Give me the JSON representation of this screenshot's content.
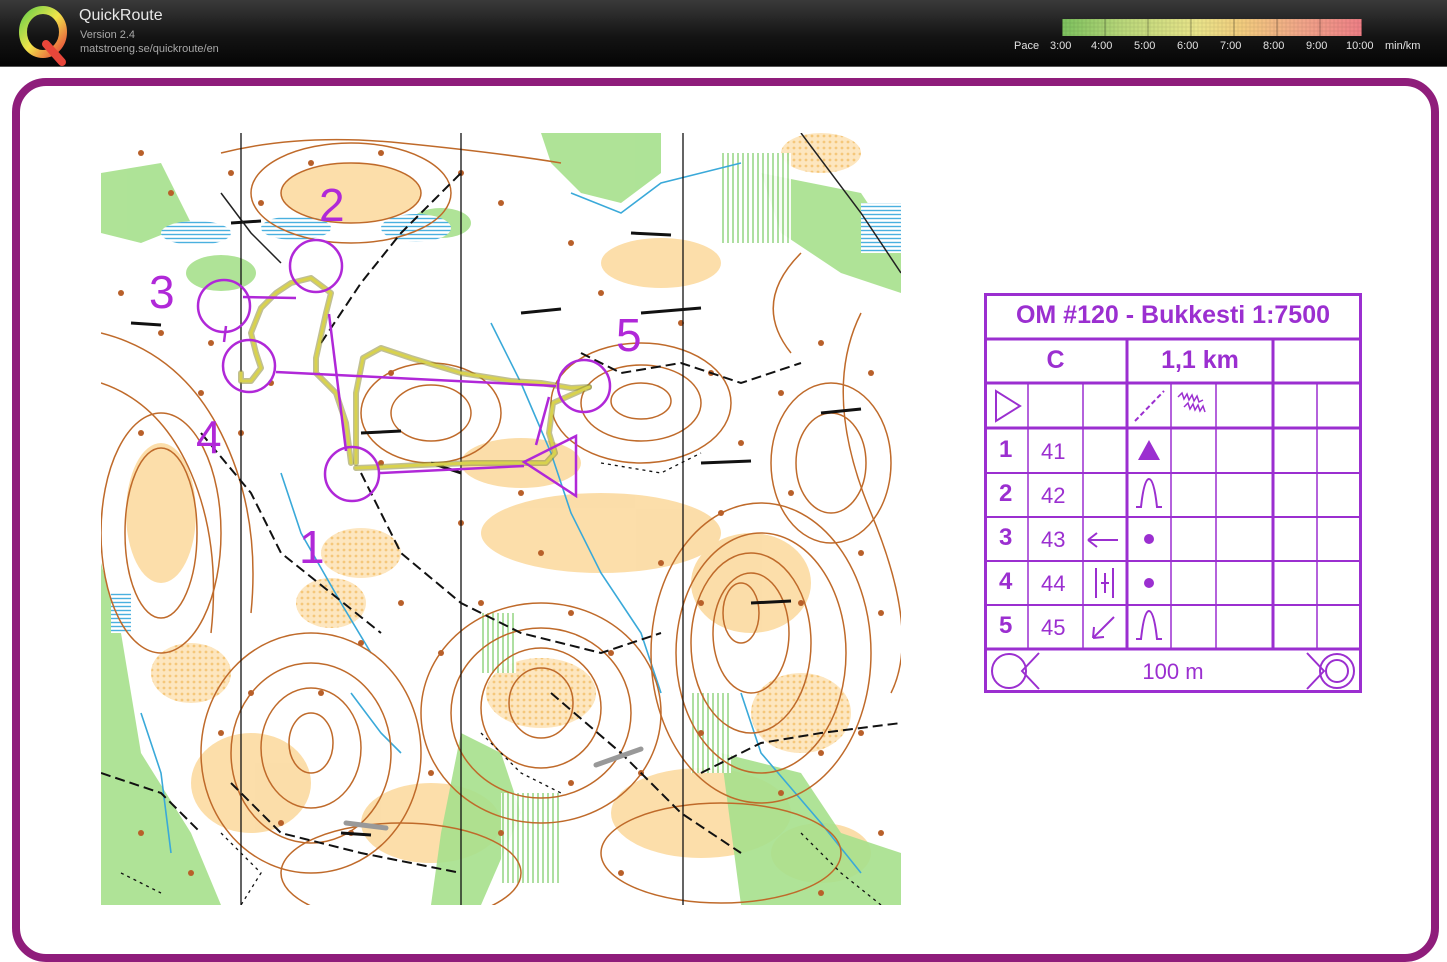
{
  "app": {
    "title": "QuickRoute",
    "version": "Version 2.4",
    "url": "matstroeng.se/quickroute/en",
    "logo_letter": "Q"
  },
  "pace_scale": {
    "prefix": "Pace",
    "labels": [
      "3:00",
      "4:00",
      "5:00",
      "6:00",
      "7:00",
      "8:00",
      "9:00",
      "10:00"
    ],
    "unit": "min/km",
    "gradient_colors": [
      "#7cc15e",
      "#b9d77a",
      "#e9e48a",
      "#f2cc7e",
      "#f1a589",
      "#ee7f86"
    ]
  },
  "frame_color": "#8f1d7b",
  "course": {
    "color": "#b028d8",
    "route_color": "#d8d24e",
    "control_labels": [
      "1",
      "2",
      "3",
      "4",
      "5"
    ]
  },
  "description": {
    "title": "OM #120 - Bukkesti 1:7500",
    "course_class": "C",
    "length": "1,1 km",
    "rows": [
      {
        "num": "1",
        "code": "41",
        "dir": "",
        "feature": "triangle"
      },
      {
        "num": "2",
        "code": "42",
        "dir": "",
        "feature": "knoll"
      },
      {
        "num": "3",
        "code": "43",
        "dir": "west-arrow",
        "feature": "dot"
      },
      {
        "num": "4",
        "code": "44",
        "dir": "between",
        "feature": "dot"
      },
      {
        "num": "5",
        "code": "45",
        "dir": "southwest-arrow",
        "feature": "knoll"
      }
    ],
    "finish_distance": "100 m"
  }
}
